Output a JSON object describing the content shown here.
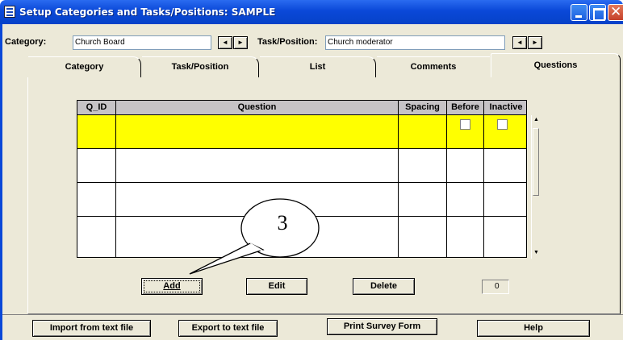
{
  "window": {
    "title": "Setup Categories and Tasks/Positions: SAMPLE"
  },
  "category": {
    "label": "Category:",
    "value": "Church Board"
  },
  "task": {
    "label": "Task/Position:",
    "value": "Church moderator"
  },
  "nav": {
    "prev_glyph": "◄",
    "next_glyph": "►"
  },
  "tabs": [
    {
      "label": "Category"
    },
    {
      "label": "Task/Position"
    },
    {
      "label": "List"
    },
    {
      "label": "Comments"
    },
    {
      "label": "Questions"
    }
  ],
  "active_tab": "Questions",
  "grid": {
    "columns": [
      "Q_ID",
      "Question",
      "Spacing",
      "Before",
      "Inactive"
    ],
    "selected_row_color": "#ffff00",
    "row_count": 4
  },
  "buttons": {
    "add": "Add",
    "edit": "Edit",
    "delete": "Delete"
  },
  "counter": "0",
  "footer": {
    "import": "Import from text file",
    "export": "Export to text file",
    "print": "Print Survey Form",
    "help": "Help"
  },
  "callout": {
    "number": "3"
  }
}
